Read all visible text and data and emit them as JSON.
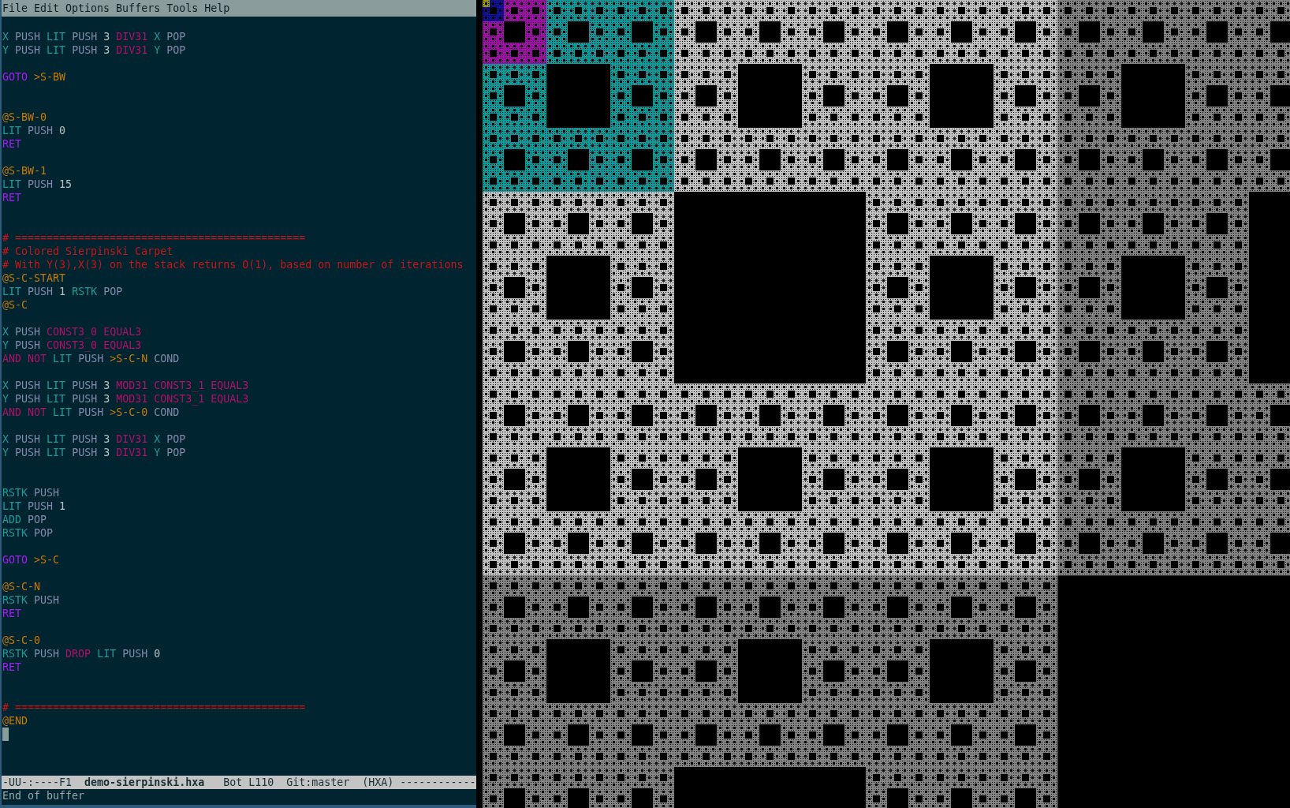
{
  "menu_bar": [
    "File",
    "Edit",
    "Options",
    "Buffers",
    "Tools",
    "Help"
  ],
  "buffer": {
    "lines": [
      {
        "kind": "blank"
      },
      {
        "kind": "code",
        "tokens": [
          {
            "text": "X",
            "kind": "reg"
          },
          {
            "text": "PUSH",
            "kind": "op"
          },
          {
            "text": "LIT",
            "kind": "reg"
          },
          {
            "text": "PUSH",
            "kind": "op"
          },
          {
            "text": "3",
            "kind": "num"
          },
          {
            "text": "DIV31",
            "kind": "func"
          },
          {
            "text": "X",
            "kind": "reg"
          },
          {
            "text": "POP",
            "kind": "op"
          }
        ]
      },
      {
        "kind": "code",
        "tokens": [
          {
            "text": "Y",
            "kind": "reg"
          },
          {
            "text": "PUSH",
            "kind": "op"
          },
          {
            "text": "LIT",
            "kind": "reg"
          },
          {
            "text": "PUSH",
            "kind": "op"
          },
          {
            "text": "3",
            "kind": "num"
          },
          {
            "text": "DIV31",
            "kind": "func"
          },
          {
            "text": "Y",
            "kind": "reg"
          },
          {
            "text": "POP",
            "kind": "op"
          }
        ]
      },
      {
        "kind": "blank"
      },
      {
        "kind": "code",
        "tokens": [
          {
            "text": "GOTO",
            "kind": "ctrl"
          },
          {
            "text": ">S-BW",
            "kind": "label"
          }
        ]
      },
      {
        "kind": "blank"
      },
      {
        "kind": "blank"
      },
      {
        "kind": "code",
        "tokens": [
          {
            "text": "@S-BW-0",
            "kind": "label"
          }
        ]
      },
      {
        "kind": "code",
        "tokens": [
          {
            "text": "LIT",
            "kind": "reg"
          },
          {
            "text": "PUSH",
            "kind": "op"
          },
          {
            "text": "0",
            "kind": "num"
          }
        ]
      },
      {
        "kind": "code",
        "tokens": [
          {
            "text": "RET",
            "kind": "ctrl"
          }
        ]
      },
      {
        "kind": "blank"
      },
      {
        "kind": "code",
        "tokens": [
          {
            "text": "@S-BW-1",
            "kind": "label"
          }
        ]
      },
      {
        "kind": "code",
        "tokens": [
          {
            "text": "LIT",
            "kind": "reg"
          },
          {
            "text": "PUSH",
            "kind": "op"
          },
          {
            "text": "15",
            "kind": "num"
          }
        ]
      },
      {
        "kind": "code",
        "tokens": [
          {
            "text": "RET",
            "kind": "ctrl"
          }
        ]
      },
      {
        "kind": "blank"
      },
      {
        "kind": "blank"
      },
      {
        "kind": "code",
        "tokens": [
          {
            "text": "# ==============================================",
            "kind": "comment"
          }
        ]
      },
      {
        "kind": "code",
        "tokens": [
          {
            "text": "# Colored Sierpinski Carpet",
            "kind": "comment"
          }
        ]
      },
      {
        "kind": "code",
        "tokens": [
          {
            "text": "# With Y(3),X(3) on the stack returns O(1), based on number of iterations",
            "kind": "comment"
          }
        ]
      },
      {
        "kind": "code",
        "tokens": [
          {
            "text": "@S-C-START",
            "kind": "label"
          }
        ]
      },
      {
        "kind": "code",
        "tokens": [
          {
            "text": "LIT",
            "kind": "reg"
          },
          {
            "text": "PUSH",
            "kind": "op"
          },
          {
            "text": "1",
            "kind": "num"
          },
          {
            "text": "RSTK",
            "kind": "reg"
          },
          {
            "text": "POP",
            "kind": "op"
          }
        ]
      },
      {
        "kind": "code",
        "tokens": [
          {
            "text": "@S-C",
            "kind": "label"
          }
        ]
      },
      {
        "kind": "blank"
      },
      {
        "kind": "code",
        "tokens": [
          {
            "text": "X",
            "kind": "reg"
          },
          {
            "text": "PUSH",
            "kind": "op"
          },
          {
            "text": "CONST3_0",
            "kind": "func"
          },
          {
            "text": "EQUAL3",
            "kind": "func"
          }
        ]
      },
      {
        "kind": "code",
        "tokens": [
          {
            "text": "Y",
            "kind": "reg"
          },
          {
            "text": "PUSH",
            "kind": "op"
          },
          {
            "text": "CONST3_0",
            "kind": "func"
          },
          {
            "text": "EQUAL3",
            "kind": "func"
          }
        ]
      },
      {
        "kind": "code",
        "tokens": [
          {
            "text": "AND",
            "kind": "func"
          },
          {
            "text": "NOT",
            "kind": "func"
          },
          {
            "text": "LIT",
            "kind": "reg"
          },
          {
            "text": "PUSH",
            "kind": "op"
          },
          {
            "text": ">S-C-N",
            "kind": "label"
          },
          {
            "text": "COND",
            "kind": "op"
          }
        ]
      },
      {
        "kind": "blank"
      },
      {
        "kind": "code",
        "tokens": [
          {
            "text": "X",
            "kind": "reg"
          },
          {
            "text": "PUSH",
            "kind": "op"
          },
          {
            "text": "LIT",
            "kind": "reg"
          },
          {
            "text": "PUSH",
            "kind": "op"
          },
          {
            "text": "3",
            "kind": "num"
          },
          {
            "text": "MOD31",
            "kind": "func"
          },
          {
            "text": "CONST3_1",
            "kind": "func"
          },
          {
            "text": "EQUAL3",
            "kind": "func"
          }
        ]
      },
      {
        "kind": "code",
        "tokens": [
          {
            "text": "Y",
            "kind": "reg"
          },
          {
            "text": "PUSH",
            "kind": "op"
          },
          {
            "text": "LIT",
            "kind": "reg"
          },
          {
            "text": "PUSH",
            "kind": "op"
          },
          {
            "text": "3",
            "kind": "num"
          },
          {
            "text": "MOD31",
            "kind": "func"
          },
          {
            "text": "CONST3_1",
            "kind": "func"
          },
          {
            "text": "EQUAL3",
            "kind": "func"
          }
        ]
      },
      {
        "kind": "code",
        "tokens": [
          {
            "text": "AND",
            "kind": "func"
          },
          {
            "text": "NOT",
            "kind": "func"
          },
          {
            "text": "LIT",
            "kind": "reg"
          },
          {
            "text": "PUSH",
            "kind": "op"
          },
          {
            "text": ">S-C-0",
            "kind": "label"
          },
          {
            "text": "COND",
            "kind": "op"
          }
        ]
      },
      {
        "kind": "blank"
      },
      {
        "kind": "code",
        "tokens": [
          {
            "text": "X",
            "kind": "reg"
          },
          {
            "text": "PUSH",
            "kind": "op"
          },
          {
            "text": "LIT",
            "kind": "reg"
          },
          {
            "text": "PUSH",
            "kind": "op"
          },
          {
            "text": "3",
            "kind": "num"
          },
          {
            "text": "DIV31",
            "kind": "func"
          },
          {
            "text": "X",
            "kind": "reg"
          },
          {
            "text": "POP",
            "kind": "op"
          }
        ]
      },
      {
        "kind": "code",
        "tokens": [
          {
            "text": "Y",
            "kind": "reg"
          },
          {
            "text": "PUSH",
            "kind": "op"
          },
          {
            "text": "LIT",
            "kind": "reg"
          },
          {
            "text": "PUSH",
            "kind": "op"
          },
          {
            "text": "3",
            "kind": "num"
          },
          {
            "text": "DIV31",
            "kind": "func"
          },
          {
            "text": "Y",
            "kind": "reg"
          },
          {
            "text": "POP",
            "kind": "op"
          }
        ]
      },
      {
        "kind": "blank"
      },
      {
        "kind": "blank"
      },
      {
        "kind": "code",
        "tokens": [
          {
            "text": "RSTK",
            "kind": "reg"
          },
          {
            "text": "PUSH",
            "kind": "op"
          }
        ]
      },
      {
        "kind": "code",
        "tokens": [
          {
            "text": "LIT",
            "kind": "reg"
          },
          {
            "text": "PUSH",
            "kind": "op"
          },
          {
            "text": "1",
            "kind": "num"
          }
        ]
      },
      {
        "kind": "code",
        "tokens": [
          {
            "text": "ADD",
            "kind": "reg"
          },
          {
            "text": "POP",
            "kind": "op"
          }
        ]
      },
      {
        "kind": "code",
        "tokens": [
          {
            "text": "RSTK",
            "kind": "reg"
          },
          {
            "text": "POP",
            "kind": "op"
          }
        ]
      },
      {
        "kind": "blank"
      },
      {
        "kind": "code",
        "tokens": [
          {
            "text": "GOTO",
            "kind": "ctrl"
          },
          {
            "text": ">S-C",
            "kind": "label"
          }
        ]
      },
      {
        "kind": "blank"
      },
      {
        "kind": "code",
        "tokens": [
          {
            "text": "@S-C-N",
            "kind": "label"
          }
        ]
      },
      {
        "kind": "code",
        "tokens": [
          {
            "text": "RSTK",
            "kind": "reg"
          },
          {
            "text": "PUSH",
            "kind": "op"
          }
        ]
      },
      {
        "kind": "code",
        "tokens": [
          {
            "text": "RET",
            "kind": "ctrl"
          }
        ]
      },
      {
        "kind": "blank"
      },
      {
        "kind": "code",
        "tokens": [
          {
            "text": "@S-C-0",
            "kind": "label"
          }
        ]
      },
      {
        "kind": "code",
        "tokens": [
          {
            "text": "RSTK",
            "kind": "reg"
          },
          {
            "text": "PUSH",
            "kind": "op"
          },
          {
            "text": "DROP",
            "kind": "func"
          },
          {
            "text": "LIT",
            "kind": "reg"
          },
          {
            "text": "PUSH",
            "kind": "op"
          },
          {
            "text": "0",
            "kind": "num"
          }
        ]
      },
      {
        "kind": "code",
        "tokens": [
          {
            "text": "RET",
            "kind": "ctrl"
          }
        ]
      },
      {
        "kind": "blank"
      },
      {
        "kind": "blank"
      },
      {
        "kind": "code",
        "tokens": [
          {
            "text": "# ==============================================",
            "kind": "comment"
          }
        ]
      },
      {
        "kind": "code",
        "tokens": [
          {
            "text": "@END",
            "kind": "label"
          }
        ]
      },
      {
        "kind": "cursor"
      }
    ]
  },
  "mode_line": "-UU-:----F1  **demo-sierpinski.hxa**   Bot L110  Git:master  (HXA) ------------",
  "echo_area": "End of buffer"
}
